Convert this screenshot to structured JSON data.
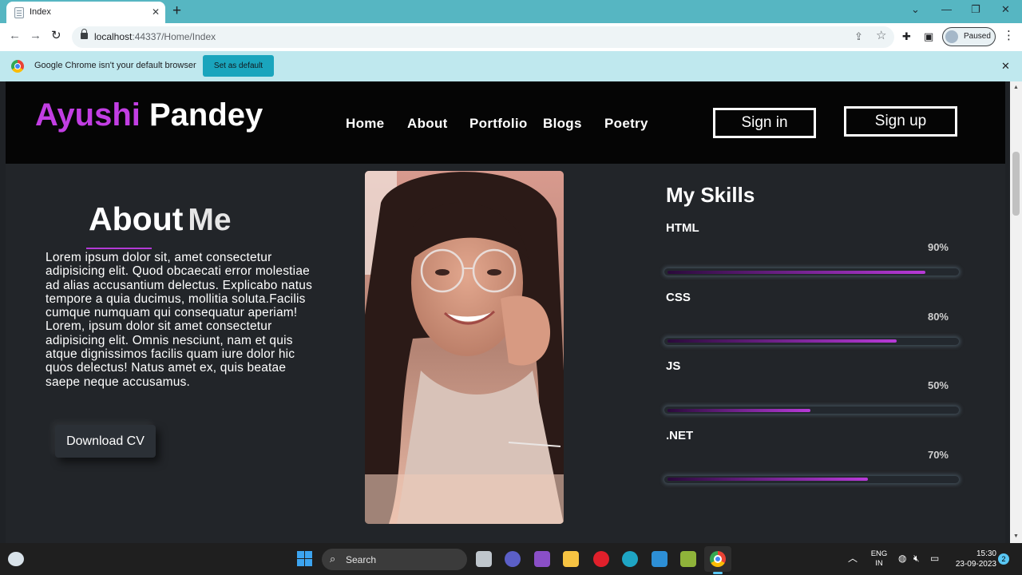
{
  "browser": {
    "tab_title": "Index",
    "url_host": "localhost",
    "url_rest": ":44337/Home/Index",
    "profile_status": "Paused",
    "infobar_text": "Google Chrome isn't your default browser",
    "infobar_button": "Set as default"
  },
  "site": {
    "brand_first": "Ayushi",
    "brand_last": "Pandey",
    "nav": [
      "Home",
      "About",
      "Portfolio",
      "Blogs",
      "Poetry"
    ],
    "signin": "Sign in",
    "signup": "Sign up",
    "about_title_a": "About",
    "about_title_b": "Me",
    "about_text": "Lorem ipsum dolor sit, amet consectetur adipisicing elit. Quod obcaecati error molestiae ad alias accusantium delectus. Explicabo natus tempore a quia ducimus, mollitia soluta.Facilis cumque numquam qui consequatur aperiam! Lorem, ipsum dolor sit amet consectetur adipisicing elit. Omnis nesciunt, nam et quis atque dignissimos facilis quam iure dolor hic quos delectus! Natus amet ex, quis beatae saepe neque accusamus.",
    "download_cv": "Download CV",
    "skills_title": "My Skills",
    "skills": [
      {
        "name": "HTML",
        "percent_label": "90%",
        "level": 0.9
      },
      {
        "name": "CSS",
        "percent_label": "80%",
        "level": 0.8
      },
      {
        "name": "JS",
        "percent_label": "50%",
        "level": 0.5
      },
      {
        "name": ".NET",
        "percent_label": "70%",
        "level": 0.7
      }
    ]
  },
  "taskbar": {
    "search_label": "Search",
    "lang_line1": "ENG",
    "lang_line2": "IN",
    "time": "15:30",
    "date": "23-09-2023",
    "notification_count": "2"
  }
}
